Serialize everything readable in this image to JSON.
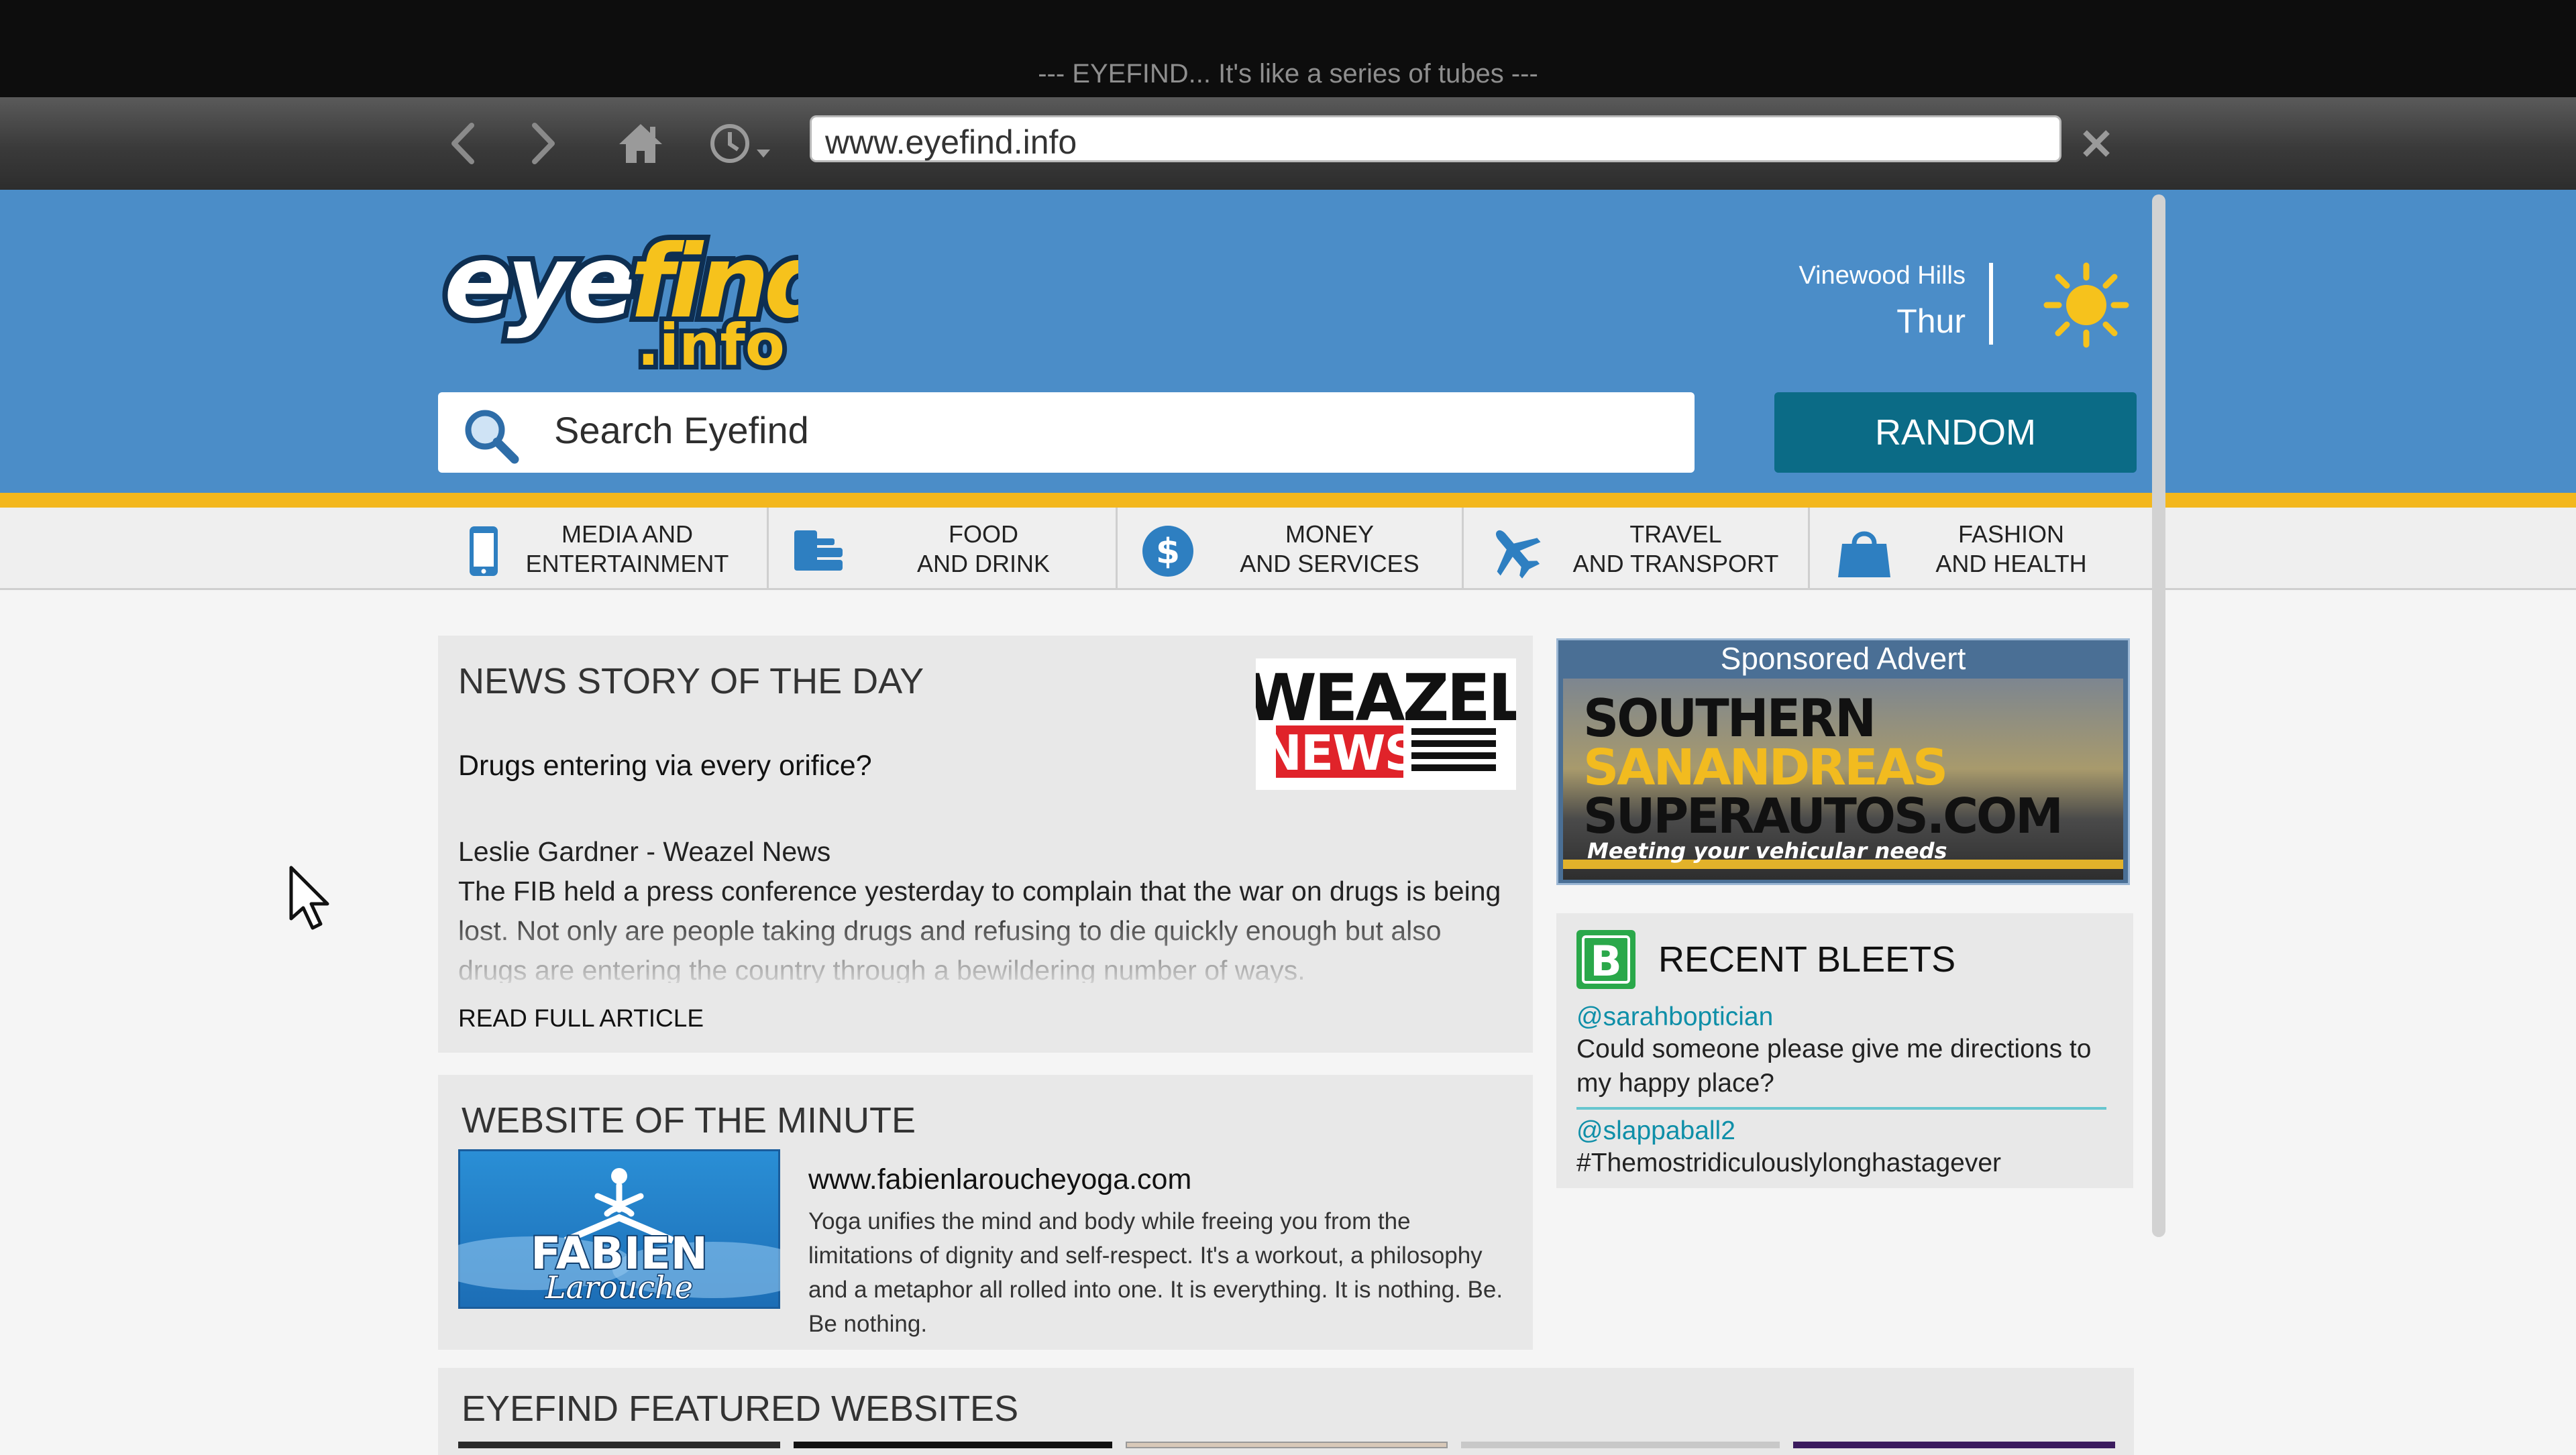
{
  "window": {
    "title": "--- EYEFIND... It's like a series of tubes ---"
  },
  "toolbar": {
    "url": "www.eyefind.info",
    "icons": [
      "back-arrow-icon",
      "forward-arrow-icon",
      "home-icon",
      "history-clock-icon",
      "close-icon"
    ]
  },
  "header": {
    "logo_main": "eyefind",
    "logo_sub": ".info",
    "location": "Vinewood Hills",
    "day": "Thur",
    "weather_icon": "sun-icon",
    "search_placeholder": "Search Eyefind",
    "random_label": "RANDOM"
  },
  "categories": [
    {
      "line1": "MEDIA AND",
      "line2": "ENTERTAINMENT",
      "icon": "tablet-icon"
    },
    {
      "line1": "FOOD",
      "line2": "AND DRINK",
      "icon": "food-icon"
    },
    {
      "line1": "MONEY",
      "line2": "AND SERVICES",
      "icon": "dollar-icon"
    },
    {
      "line1": "TRAVEL",
      "line2": "AND TRANSPORT",
      "icon": "airplane-icon"
    },
    {
      "line1": "FASHION",
      "line2": "AND HEALTH",
      "icon": "shopping-bag-icon"
    }
  ],
  "news": {
    "heading": "NEWS STORY OF THE DAY",
    "logo_top": "WEAZEL",
    "logo_bottom": "NEWS",
    "headline": "Drugs entering via every orifice?",
    "author": "Leslie Gardner - Weazel News",
    "body": "The FIB held a press conference yesterday to complain that the war on drugs is being lost. Not only are people taking drugs and refusing to die quickly enough but also drugs are entering the country through a bewildering number of ways.",
    "read_more": "READ FULL ARTICLE"
  },
  "website_of_minute": {
    "heading": "WEBSITE OF THE MINUTE",
    "logo_top": "FABIEN",
    "logo_bottom": "Larouche",
    "url": "www.fabienlaroucheyoga.com",
    "description": "Yoga unifies the mind and body while freeing you from the limitations of dignity and self-respect. It's a workout, a philosophy and a metaphor all rolled into one. It is everything. It is nothing. Be. Be nothing."
  },
  "featured": {
    "heading": "EYEFIND FEATURED WEBSITES"
  },
  "advert": {
    "title": "Sponsored Advert",
    "line1": "SOUTHERN",
    "line2": "SANANDREAS",
    "line3": "SUPERAUTOS.COM",
    "tagline": "Meeting your vehicular needs"
  },
  "bleets": {
    "heading": "RECENT BLEETS",
    "icon_letter": "B",
    "items": [
      {
        "handle": "@sarahboptician",
        "text": "Could someone please give me directions to my happy place?"
      },
      {
        "handle": "@slappaball2",
        "text": "#Themostridiculouslylonghastagever"
      }
    ]
  },
  "colors": {
    "header_blue": "#4b8dc8",
    "accent_yellow": "#f3b71d",
    "random_button": "#0b6b86",
    "bleet_handle": "#0f8fa8",
    "bleeter_green": "#2aa84a"
  }
}
